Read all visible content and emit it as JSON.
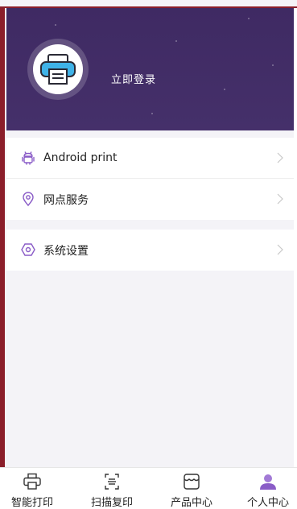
{
  "header": {
    "login_label": "立即登录",
    "avatar_icon": "printer-icon"
  },
  "menu": {
    "group1": [
      {
        "label": "Android print",
        "icon": "android-icon"
      },
      {
        "label": "网点服务",
        "icon": "location-pin-icon"
      }
    ],
    "group2": [
      {
        "label": "系统设置",
        "icon": "settings-hexagon-icon"
      }
    ]
  },
  "tabbar": {
    "items": [
      {
        "label": "智能打印",
        "icon": "printer-outline-icon",
        "active": false
      },
      {
        "label": "扫描复印",
        "icon": "scan-icon",
        "active": false
      },
      {
        "label": "产品中心",
        "icon": "store-icon",
        "active": false
      },
      {
        "label": "个人中心",
        "icon": "user-icon",
        "active": true
      }
    ]
  },
  "colors": {
    "header_bg": "#3f2a63",
    "accent": "#8a5cc7",
    "page_bg": "#f4f3f7"
  }
}
